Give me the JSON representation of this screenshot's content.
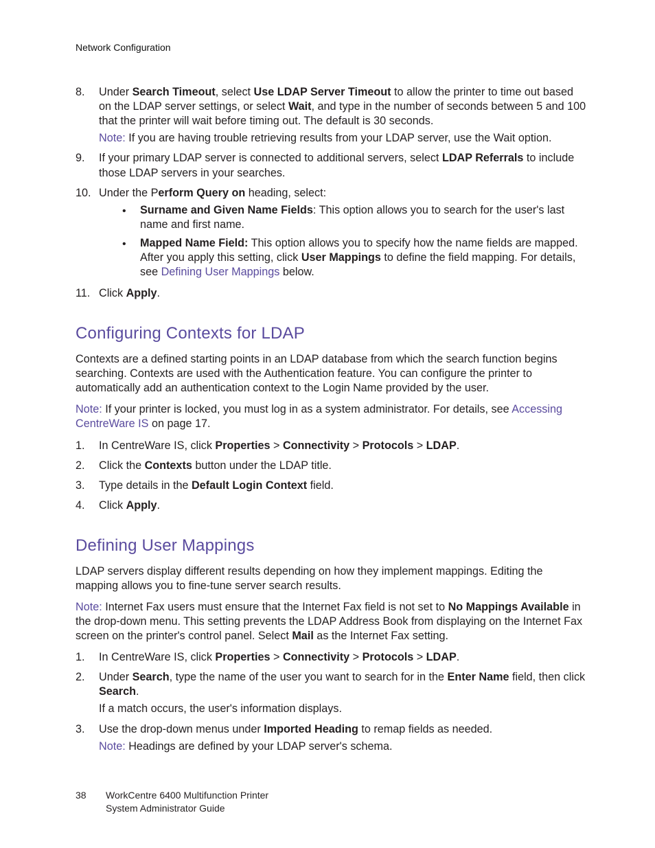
{
  "header": {
    "running": "Network Configuration"
  },
  "list1": {
    "i8": {
      "num": "8.",
      "text": {
        "t1": "Under ",
        "b1": "Search Timeout",
        "t2": ", select ",
        "b2": "Use LDAP Server Timeout",
        "t3": " to allow the printer to time out based on the LDAP server settings, or select ",
        "b3": "Wait",
        "t4": ", and type in the number of seconds between 5 and 100 that the printer will wait before timing out. The default is 30 seconds."
      },
      "note": {
        "label": "Note:",
        "text": " If you are having trouble retrieving results from your LDAP server, use the Wait option."
      }
    },
    "i9": {
      "num": "9.",
      "text": {
        "t1": "If your primary LDAP server is connected to additional servers, select ",
        "b1": "LDAP Referrals",
        "t2": " to include those LDAP servers in your searches."
      }
    },
    "i10": {
      "num": "10.",
      "text": {
        "t1": "Under the P",
        "b1": "erform Query on",
        "t2": " heading, select:"
      },
      "bullets": {
        "b1": {
          "bold": "Surname and Given Name Fields",
          "text": ": This option allows you to search for the user's last name and first name."
        },
        "b2": {
          "bold": "Mapped Name Field:",
          "t1": " This option allows you to specify how the name fields are mapped. After you apply this setting, click ",
          "b2": "User Mappings",
          "t2": " to define the field mapping. For details, see ",
          "link": "Defining User Mappings",
          "t3": " below."
        }
      }
    },
    "i11": {
      "num": "11.",
      "t1": "Click ",
      "b1": "Apply",
      "t2": "."
    }
  },
  "section1": {
    "title": "Configuring Contexts for LDAP",
    "intro": "Contexts are a defined starting points in an LDAP database from which the search function begins searching. Contexts are used with the Authentication feature. You can configure the printer to automatically add an authentication context to the Login Name provided by the user.",
    "note": {
      "label": "Note:",
      "t1": " If your printer is locked, you must log in as a system administrator. For details, see ",
      "link": "Accessing CentreWare IS",
      "t2": " on page 17."
    },
    "steps": {
      "s1": {
        "num": "1.",
        "t1": "In CentreWare IS, click ",
        "b1": "Properties",
        "sep1": " > ",
        "b2": "Connectivity",
        "sep2": " > ",
        "b3": "Protocols",
        "sep3": " > ",
        "b4": "LDAP",
        "t2": "."
      },
      "s2": {
        "num": "2.",
        "t1": "Click the ",
        "b1": "Contexts",
        "t2": " button under the LDAP title."
      },
      "s3": {
        "num": "3.",
        "t1": "Type details in the ",
        "b1": "Default Login Context",
        "t2": " field."
      },
      "s4": {
        "num": "4.",
        "t1": "Click ",
        "b1": "Apply",
        "t2": "."
      }
    }
  },
  "section2": {
    "title": "Defining User Mappings",
    "intro": "LDAP servers display different results depending on how they implement mappings. Editing the mapping allows you to fine-tune server search results.",
    "note": {
      "label": "Note:",
      "t1": " Internet Fax users must ensure that the Internet Fax field is not set to ",
      "b1": "No Mappings Available",
      "t2": " in the drop-down menu. This setting prevents the LDAP Address Book from displaying on the Internet Fax screen on the printer's control panel. Select ",
      "b2": "Mail",
      "t3": " as the Internet Fax setting."
    },
    "steps": {
      "s1": {
        "num": "1.",
        "t1": "In CentreWare IS, click ",
        "b1": "Properties",
        "sep1": " > ",
        "b2": "Connectivity",
        "sep2": " > ",
        "b3": "Protocols",
        "sep3": " > ",
        "b4": "LDAP",
        "t2": "."
      },
      "s2": {
        "num": "2.",
        "t1": "Under ",
        "b1": "Search",
        "t2": ", type the name of the user you want to search for in the ",
        "b2": "Enter Name",
        "t3": " field, then click ",
        "b3": "Search",
        "t4": ".",
        "cont": "If a match occurs, the user's information displays."
      },
      "s3": {
        "num": "3.",
        "t1": "Use the drop-down menus under ",
        "b1": "Imported Heading",
        "t2": " to remap fields as needed.",
        "note": {
          "label": "Note:",
          "text": " Headings are defined by your LDAP server's schema."
        }
      }
    }
  },
  "footer": {
    "page": "38",
    "line1": "WorkCentre 6400 Multifunction Printer",
    "line2": "System Administrator Guide"
  }
}
